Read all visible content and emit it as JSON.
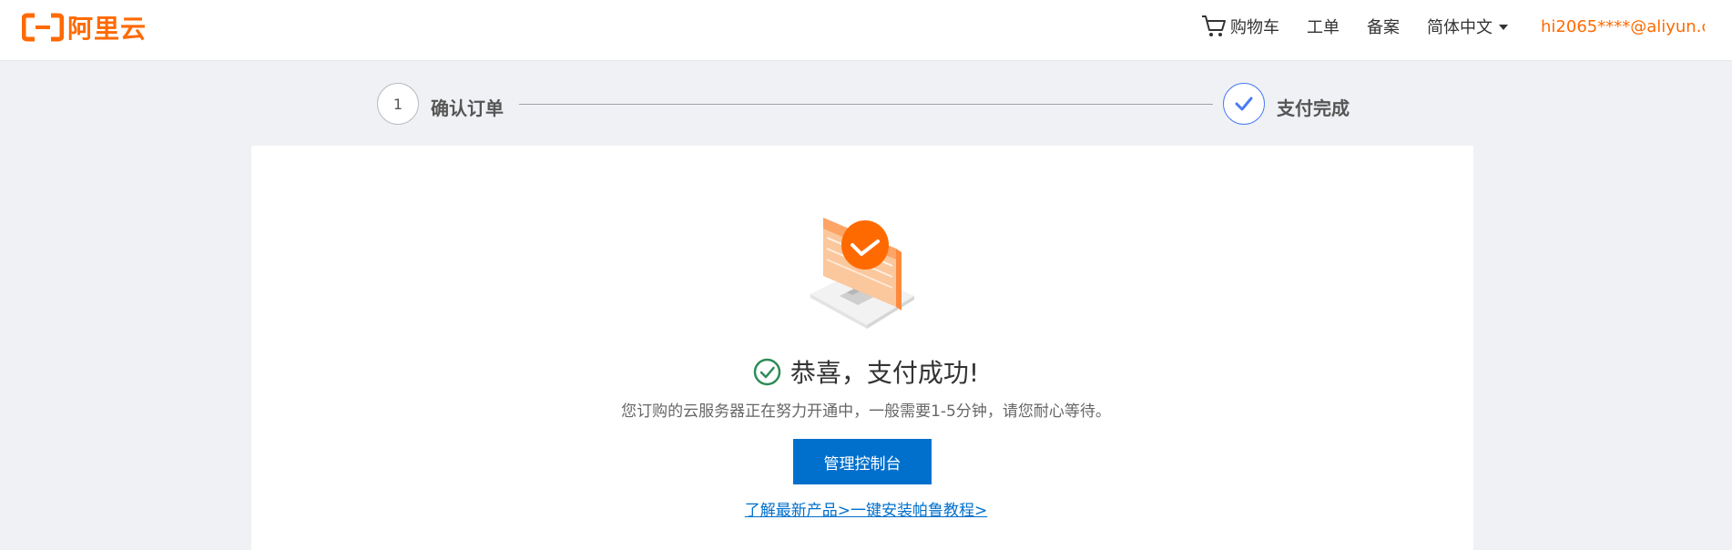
{
  "header": {
    "logo_text": "阿里云",
    "brand_color": "#ff6a00",
    "nav": {
      "cart_icon": "shopping-cart-icon",
      "cart_label": "购物车",
      "ticket_label": "工单",
      "filing_label": "备案",
      "language_label": "简体中文",
      "user_account": "hi2065****@aliyun.c..."
    }
  },
  "steps": [
    {
      "marker": "1",
      "label": "确认订单"
    },
    {
      "marker_icon": "checkmark-icon",
      "label": "支付完成"
    }
  ],
  "result": {
    "status_icon": "success-check-circle-icon",
    "title": "恭喜，支付成功!",
    "message": "您订购的云服务器正在努力开通中，一般需要1-5分钟，请您耐心等待。",
    "primary_button": "管理控制台",
    "link_text": "了解最新产品>一键安装帕鲁教程>"
  },
  "colors": {
    "primary": "#0070cc",
    "success": "#2e8b57",
    "step_active": "#4a7cf6"
  }
}
